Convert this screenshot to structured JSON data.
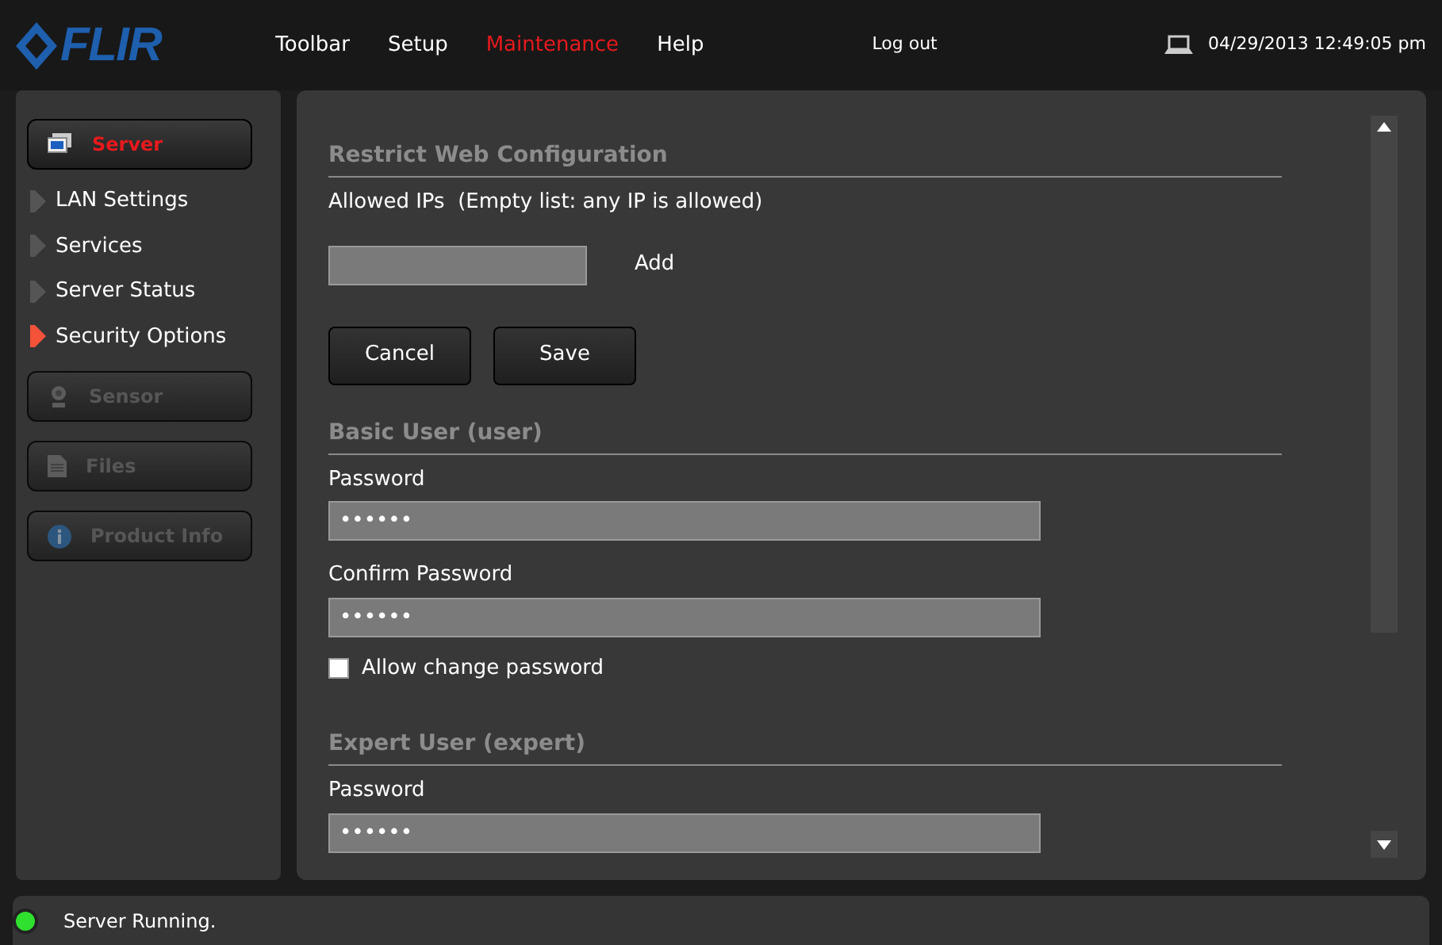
{
  "header": {
    "logo": "FLIR",
    "nav": [
      {
        "label": "Toolbar",
        "selected": false
      },
      {
        "label": "Setup",
        "selected": false
      },
      {
        "label": "Maintenance",
        "selected": true
      },
      {
        "label": "Help",
        "selected": false
      }
    ],
    "logout": "Log out",
    "datetime": "04/29/2013 12:49:05 pm"
  },
  "sidebar": {
    "sections": [
      {
        "label": "Server",
        "kind": "server",
        "selected": true,
        "disabled": false,
        "items": [
          {
            "label": "LAN Settings",
            "selected": false
          },
          {
            "label": "Services",
            "selected": false
          },
          {
            "label": "Server Status",
            "selected": false
          },
          {
            "label": "Security Options",
            "selected": true
          }
        ]
      },
      {
        "label": "Sensor",
        "kind": "sensor",
        "selected": false,
        "disabled": true
      },
      {
        "label": "Files",
        "kind": "files",
        "selected": false,
        "disabled": true
      },
      {
        "label": "Product Info",
        "kind": "info",
        "selected": false,
        "disabled": true
      }
    ]
  },
  "restrict": {
    "title": "Restrict Web Configuration",
    "allowed_label": "Allowed IPs  (Empty list: any IP is allowed)",
    "add": "Add",
    "buttons": [
      "Cancel",
      "Save"
    ]
  },
  "basic_user": {
    "title": "Basic User (user)",
    "fields": [
      {
        "label": "Password",
        "value": "••••••"
      },
      {
        "label": "Confirm Password",
        "value": "••••••"
      }
    ],
    "allow_change": {
      "label": "Allow change password",
      "checked": false
    }
  },
  "expert_user": {
    "title": "Expert User (expert)",
    "fields": [
      {
        "label": "Password",
        "value": "••••••"
      }
    ]
  },
  "status_bar": {
    "text": "Server Running.",
    "running": true
  }
}
